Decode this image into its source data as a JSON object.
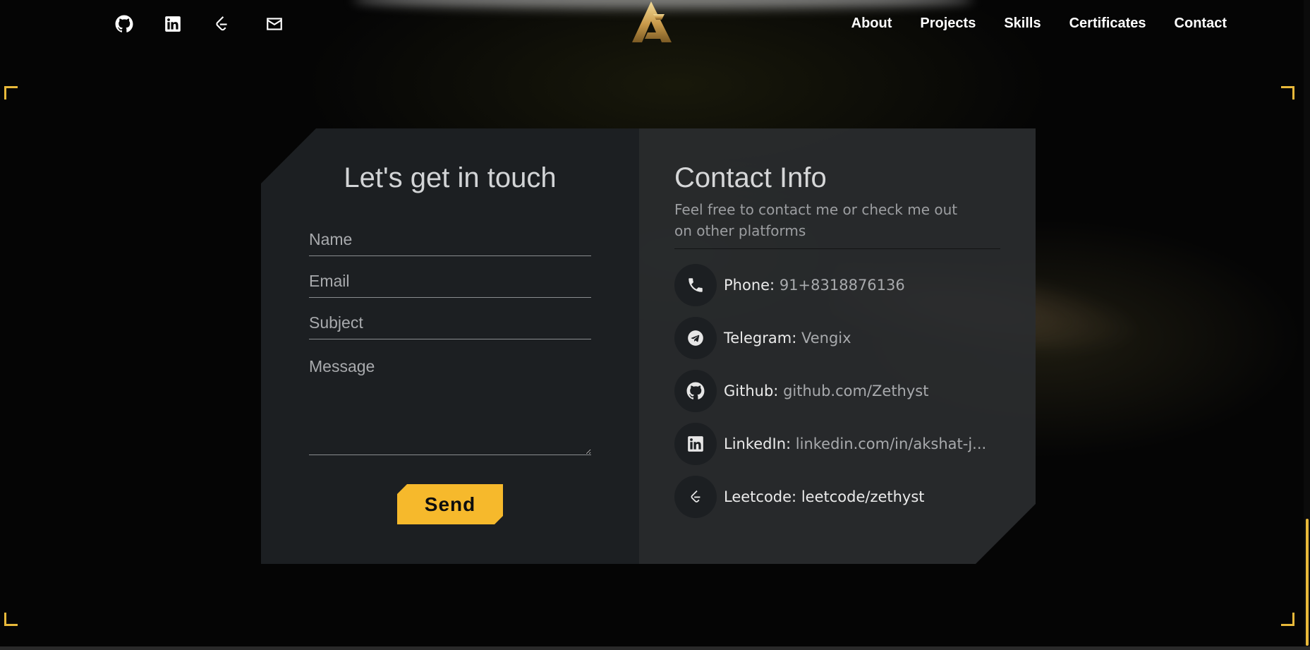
{
  "header": {
    "social": [
      {
        "name": "github-icon"
      },
      {
        "name": "linkedin-icon"
      },
      {
        "name": "leetcode-icon"
      },
      {
        "name": "mail-icon"
      }
    ],
    "nav": [
      "About",
      "Projects",
      "Skills",
      "Certificates",
      "Contact"
    ]
  },
  "form": {
    "title": "Let's get in touch",
    "name_placeholder": "Name",
    "email_placeholder": "Email",
    "subject_placeholder": "Subject",
    "message_placeholder": "Message",
    "send_label": "Send"
  },
  "contact_info": {
    "title": "Contact Info",
    "subtitle": "Feel free to contact me or check me out on other platforms",
    "items": [
      {
        "icon": "phone-icon",
        "key": "Phone:",
        "value": "91+8318876136"
      },
      {
        "icon": "telegram-icon",
        "key": "Telegram:",
        "value": "Vengix"
      },
      {
        "icon": "github-icon",
        "key": "Github:",
        "value": "github.com/Zethyst"
      },
      {
        "icon": "linkedin-icon",
        "key": "LinkedIn:",
        "value": "linkedin.com/in/akshat-j..."
      },
      {
        "icon": "leetcode-icon",
        "key": "Leetcode:",
        "value": "leetcode/zethyst"
      }
    ]
  },
  "colors": {
    "accent": "#f6b92c",
    "panel": "#1c1f22",
    "panel_right": "#2a2c2e"
  }
}
